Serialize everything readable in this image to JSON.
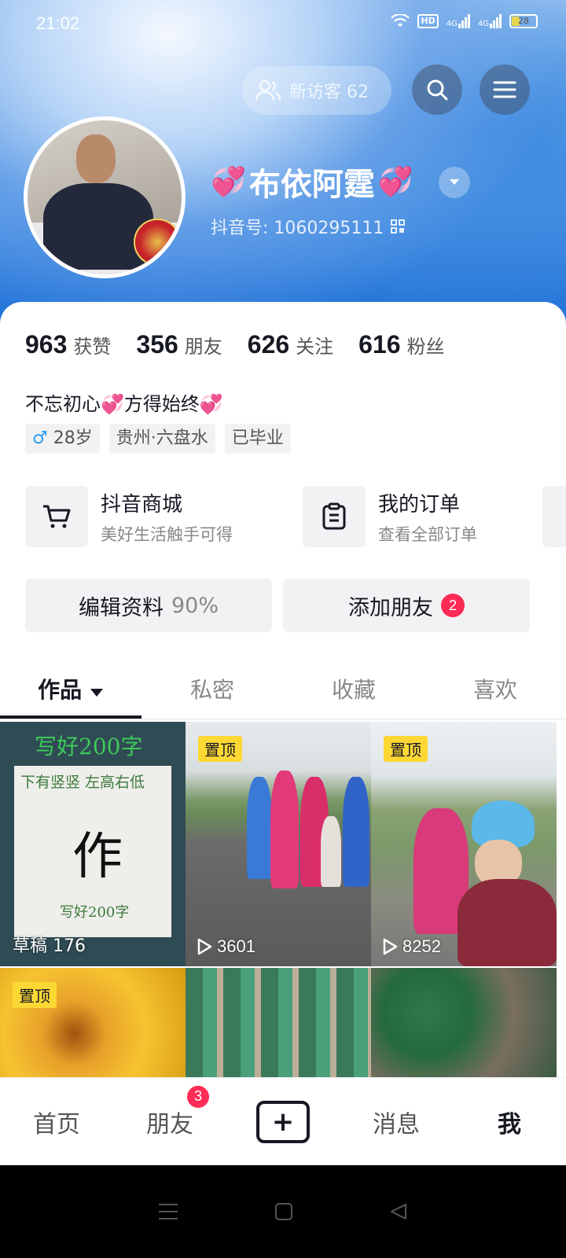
{
  "status_bar": {
    "time": "21:02",
    "hd_label": "HD",
    "signal1": "4G",
    "signal2": "4G",
    "battery": "28"
  },
  "header": {
    "visitor_label": "新访客 62",
    "username_left_emoji": "💞",
    "username": "布依阿霆",
    "username_right_emoji": "💞",
    "douyin_id": "抖音号: 1060295111"
  },
  "stats": [
    {
      "num": "963",
      "label": "获赞"
    },
    {
      "num": "356",
      "label": "朋友"
    },
    {
      "num": "626",
      "label": "关注"
    },
    {
      "num": "616",
      "label": "粉丝"
    }
  ],
  "bio": "不忘初心💞方得始终💞",
  "tags": {
    "gender_symbol": "♂",
    "age": "28岁",
    "location": "贵州·六盘水",
    "education": "已毕业"
  },
  "shortcuts": [
    {
      "title": "抖音商城",
      "subtitle": "美好生活触手可得"
    },
    {
      "title": "我的订单",
      "subtitle": "查看全部订单"
    }
  ],
  "actions": {
    "edit_label": "编辑资料",
    "edit_percent": "90%",
    "add_friend_label": "添加朋友",
    "add_friend_badge": "2"
  },
  "tabs": [
    "作品",
    "私密",
    "收藏",
    "喜欢"
  ],
  "grid": {
    "draft_label": "草稿 176",
    "pinned_label": "置顶",
    "cell1_title": "写好200字",
    "cell1_subtitle": "下有竖竖 左高右低",
    "cell1_char": "作",
    "cell1_footer": "写好200字",
    "video2_plays": "3601",
    "video3_plays": "8252"
  },
  "bottom_nav": {
    "home": "首页",
    "friends": "朋友",
    "friends_badge": "3",
    "messages": "消息",
    "me": "我"
  },
  "colors": {
    "accent_red": "#fe2c55",
    "pin_yellow": "#fdd835",
    "text_primary": "#161823"
  }
}
